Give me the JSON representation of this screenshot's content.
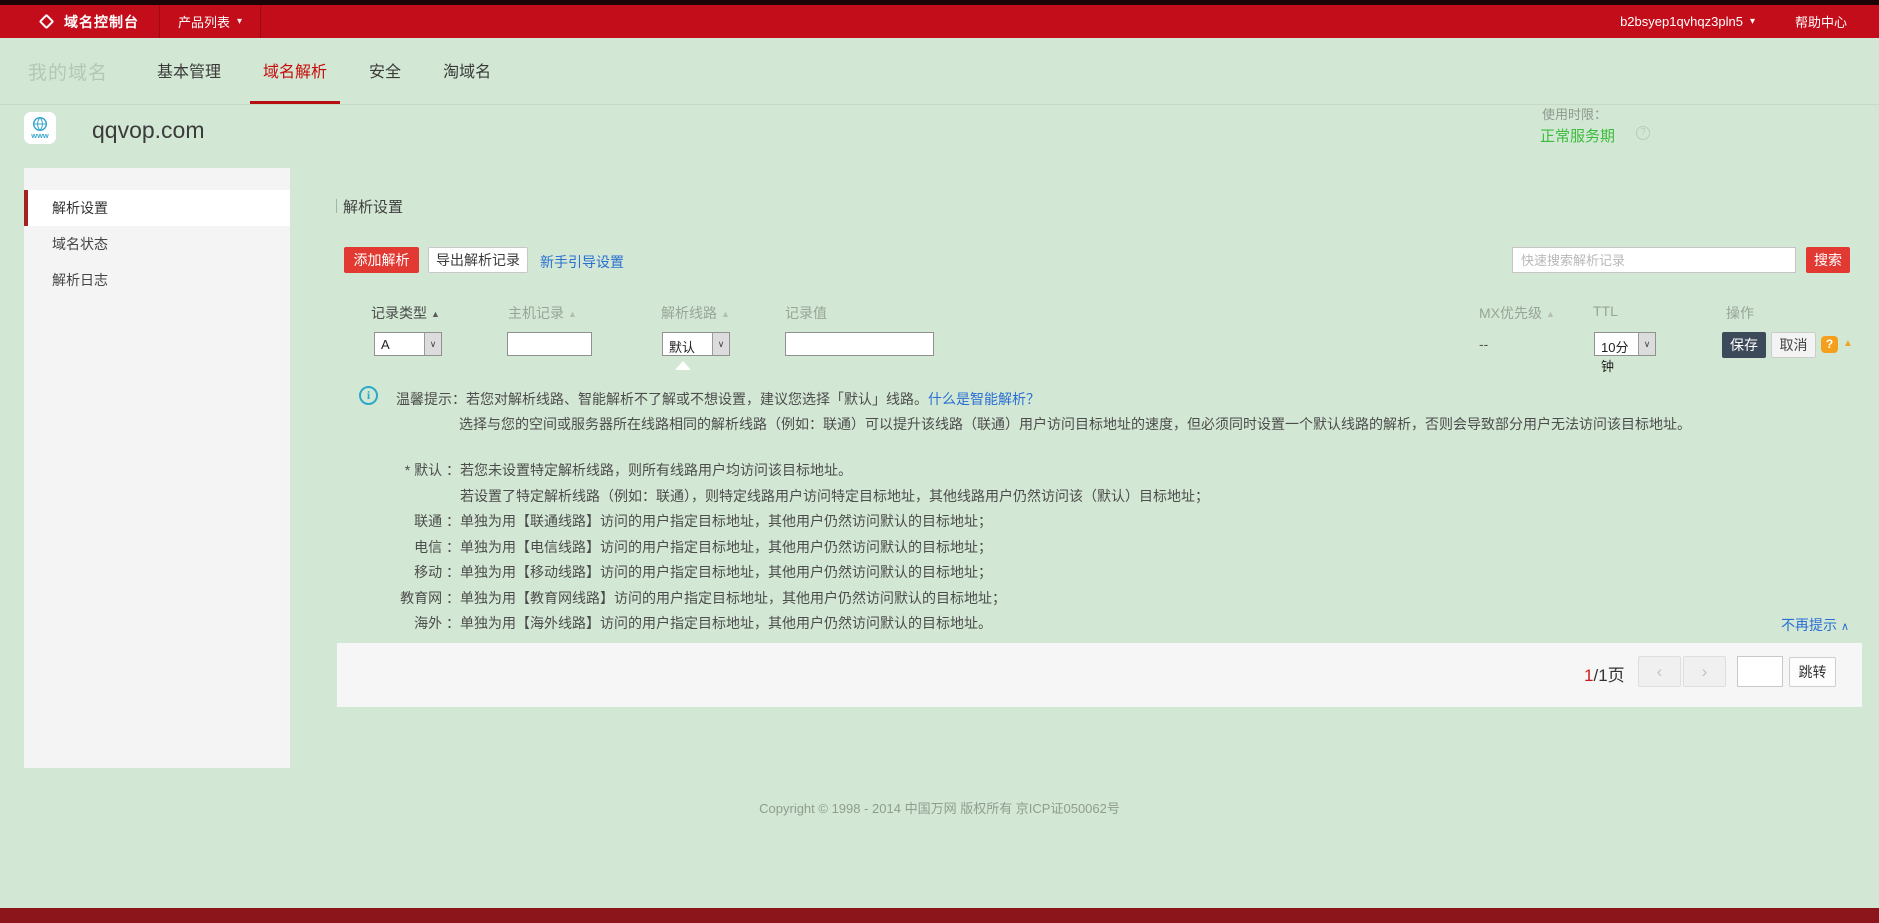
{
  "topbar": {
    "brand": "域名控制台",
    "product_menu": "产品列表",
    "account": "b2bsyep1qvhqz3pln5",
    "help_center": "帮助中心"
  },
  "tabbar": {
    "section_title": "我的域名",
    "tabs": [
      {
        "label": "基本管理",
        "active": false
      },
      {
        "label": "域名解析",
        "active": true
      },
      {
        "label": "安全",
        "active": false
      },
      {
        "label": "淘域名",
        "active": false
      }
    ]
  },
  "domain": {
    "name": "qqvop.com",
    "icon_text": "www",
    "usage_label": "使用时限：",
    "status": "正常服务期"
  },
  "sidebar": {
    "items": [
      {
        "label": "解析设置",
        "active": true
      },
      {
        "label": "域名状态",
        "active": false
      },
      {
        "label": "解析日志",
        "active": false
      }
    ]
  },
  "main": {
    "title": "解析设置",
    "toolbar": {
      "add_label": "添加解析",
      "export_label": "导出解析记录",
      "guide_label": "新手引导设置",
      "search_placeholder": "快速搜索解析记录",
      "search_button": "搜索"
    },
    "table": {
      "headers": [
        "记录类型",
        "主机记录",
        "解析线路",
        "记录值",
        "MX优先级",
        "TTL",
        "操作"
      ],
      "form": {
        "record_type": "A",
        "line": "默认",
        "mx_priority": "--",
        "ttl": "10分钟",
        "save_label": "保存",
        "cancel_label": "取消"
      }
    },
    "tips": {
      "line1": "温馨提示：若您对解析线路、智能解析不了解或不想设置，建议您选择「默认」线路。",
      "link": "什么是智能解析？",
      "line2": "选择与您的空间或服务器所在线路相同的解析线路（例如：联通）可以提升该线路（联通）用户访问目标地址的速度，但必须同时设置一个默认线路的解析，否则会导致部分用户无法访问该目标地址。",
      "rows": [
        {
          "label": "* 默认 ：",
          "text": "若您未设置特定解析线路，则所有线路用户均访问该目标地址。"
        },
        {
          "label": "",
          "text": "若设置了特定解析线路（例如：联通），则特定线路用户访问特定目标地址，其他线路用户仍然访问该（默认）目标地址；"
        },
        {
          "label": "联通 ：",
          "text": "单独为用【联通线路】访问的用户指定目标地址，其他用户仍然访问默认的目标地址；"
        },
        {
          "label": "电信 ：",
          "text": "单独为用【电信线路】访问的用户指定目标地址，其他用户仍然访问默认的目标地址；"
        },
        {
          "label": "移动 ：",
          "text": "单独为用【移动线路】访问的用户指定目标地址，其他用户仍然访问默认的目标地址；"
        },
        {
          "label": "教育网 ：",
          "text": "单独为用【教育网线路】访问的用户指定目标地址，其他用户仍然访问默认的目标地址；"
        },
        {
          "label": "海外 ：",
          "text": "单独为用【海外线路】访问的用户指定目标地址，其他用户仍然访问默认的目标地址。"
        }
      ]
    },
    "no_more_label": "不再提示",
    "pagination": {
      "current": "1",
      "suffix": "/1页",
      "jump_label": "跳转"
    }
  },
  "footer": {
    "copyright": "Copyright © 1998 - 2014 中国万网 版权所有 京ICP证050062号"
  },
  "icons": {
    "caret_down": "▾",
    "collapse_up": "∧",
    "sort_asc": "▲",
    "select_arrow": "∨",
    "question": "?",
    "info": "i",
    "prev": "‹",
    "next": "›"
  }
}
